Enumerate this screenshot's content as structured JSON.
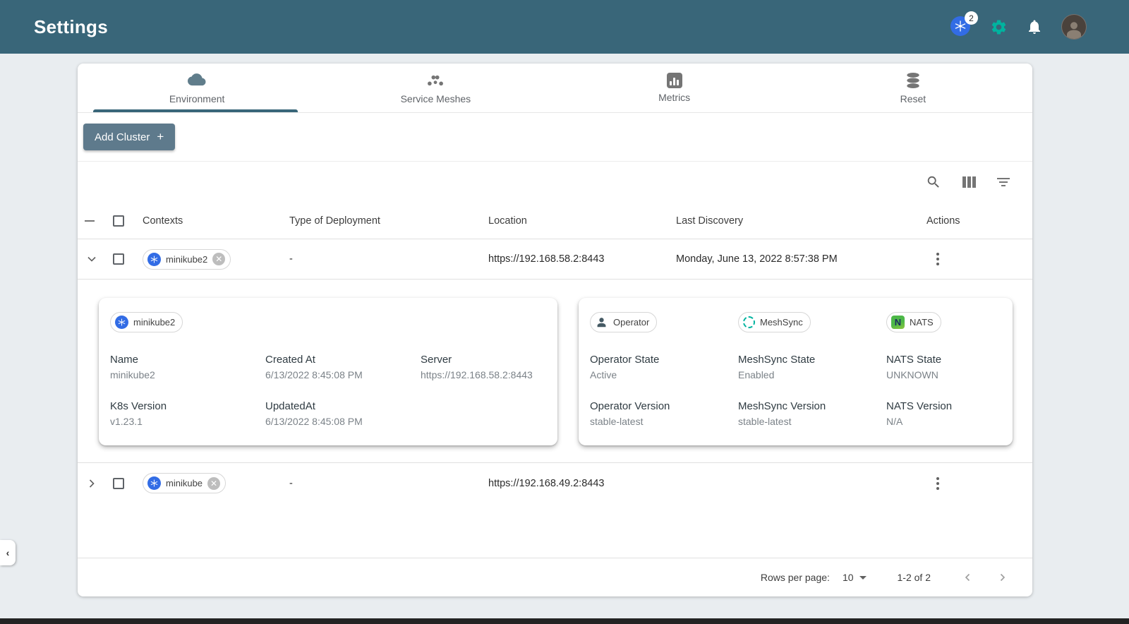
{
  "header": {
    "title": "Settings",
    "kubernetes_badge": "2",
    "icons": [
      "kubernetes-cluster-icon",
      "settings-gear-icon",
      "notifications-bell-icon",
      "user-avatar"
    ]
  },
  "tabs": [
    {
      "label": "Environment",
      "icon": "cloud-icon",
      "active": true
    },
    {
      "label": "Service Meshes",
      "icon": "mesh-dots-icon",
      "active": false
    },
    {
      "label": "Metrics",
      "icon": "bar-chart-icon",
      "active": false
    },
    {
      "label": "Reset",
      "icon": "database-icon",
      "active": false
    }
  ],
  "toolbar": {
    "add_cluster_label": "Add Cluster",
    "add_cluster_plus": "+",
    "icons": [
      "search-icon",
      "view-columns-icon",
      "filter-icon"
    ]
  },
  "table": {
    "columns": [
      "Contexts",
      "Type of Deployment",
      "Location",
      "Last Discovery",
      "Actions"
    ],
    "rows": [
      {
        "context": "minikube2",
        "deployment": "-",
        "location": "https://192.168.58.2:8443",
        "last_discovery": "Monday, June 13, 2022 8:57:38 PM"
      },
      {
        "context": "minikube",
        "deployment": "-",
        "location": "https://192.168.49.2:8443",
        "last_discovery": ""
      }
    ]
  },
  "details": {
    "cluster_chip": "minikube2",
    "left_fields": [
      {
        "label": "Name",
        "value": "minikube2"
      },
      {
        "label": "Created At",
        "value": "6/13/2022 8:45:08 PM"
      },
      {
        "label": "Server",
        "value": "https://192.168.58.2:8443"
      },
      {
        "label": "K8s Version",
        "value": "v1.23.1"
      },
      {
        "label": "UpdatedAt",
        "value": "6/13/2022 8:45:08 PM"
      }
    ],
    "right_chips": [
      {
        "label": "Operator",
        "icon": "operator-person-icon"
      },
      {
        "label": "MeshSync",
        "icon": "meshsync-ring-icon"
      },
      {
        "label": "NATS",
        "icon": "nats-logo-icon",
        "icon_letter": "N"
      }
    ],
    "right_fields": [
      {
        "label": "Operator State",
        "value": "Active"
      },
      {
        "label": "MeshSync State",
        "value": "Enabled"
      },
      {
        "label": "NATS State",
        "value": "UNKNOWN"
      },
      {
        "label": "Operator Version",
        "value": "stable-latest"
      },
      {
        "label": "MeshSync Version",
        "value": "stable-latest"
      },
      {
        "label": "NATS Version",
        "value": "N/A"
      }
    ]
  },
  "pagination": {
    "rows_per_page_label": "Rows per page:",
    "rows_per_page_value": "10",
    "range": "1-2 of 2"
  },
  "collapse_tab_glyph": "‹",
  "chip_close_glyph": "✕",
  "colors": {
    "appbar": "#396679",
    "accent_green": "#00B39F",
    "kubernetes_blue": "#326CE5",
    "button": "#5E7A8C"
  }
}
